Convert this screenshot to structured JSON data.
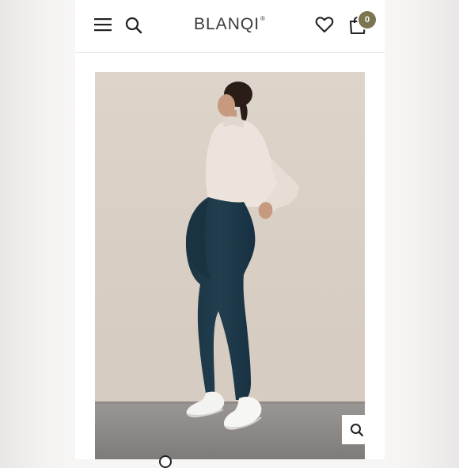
{
  "header": {
    "logo_text": "BLANQI",
    "logo_mark": "®",
    "cart_count": "0",
    "icons": [
      "menu-icon",
      "search-icon",
      "heart-icon",
      "cart-icon"
    ],
    "badge_color": "#7b7650"
  },
  "product_gallery": {
    "zoom_icon": "zoom-search-icon",
    "active_slide": 1
  }
}
